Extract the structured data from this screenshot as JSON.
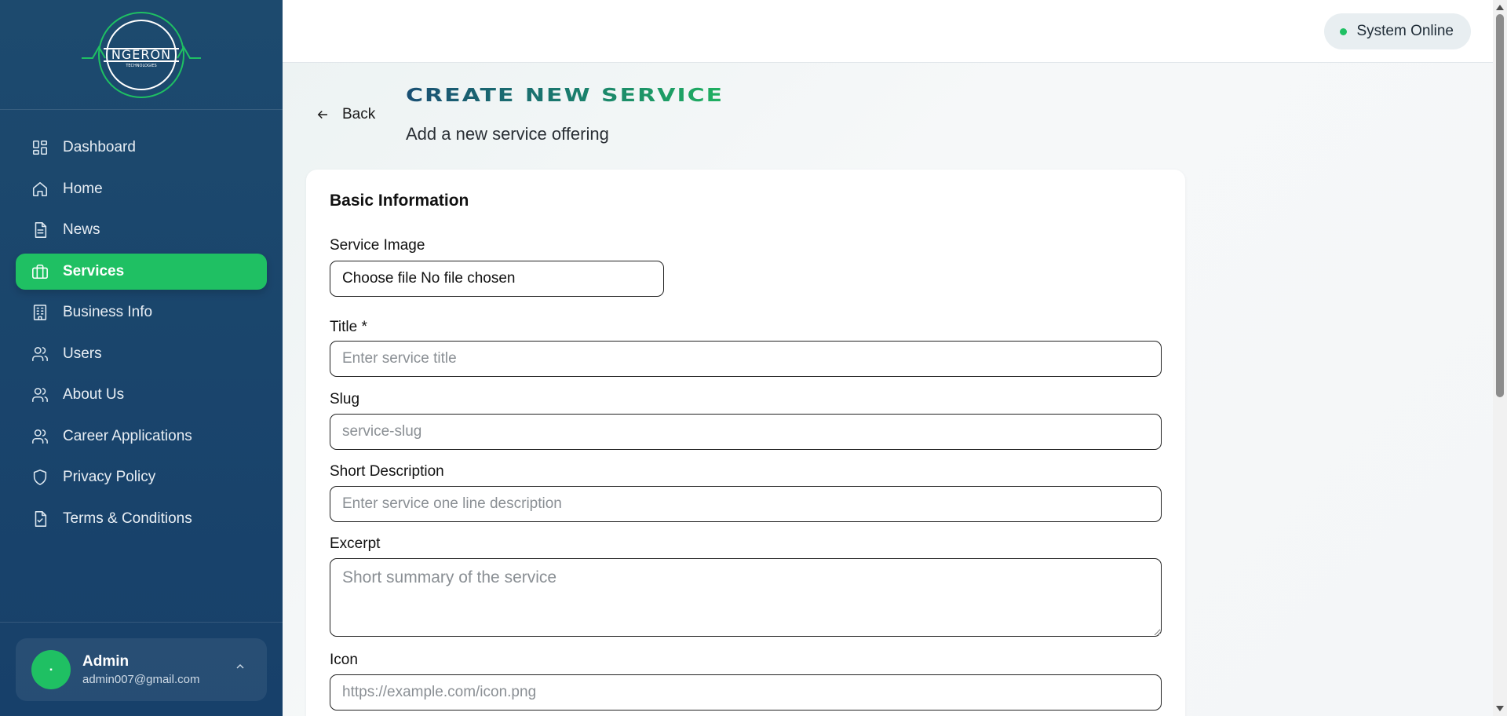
{
  "sidebar": {
    "logo_icon": "angeron-technologies-logo",
    "items": [
      {
        "label": "Dashboard",
        "icon": "dashboard-icon",
        "active": false
      },
      {
        "label": "Home",
        "icon": "home-icon",
        "active": false
      },
      {
        "label": "News",
        "icon": "news-icon",
        "active": false
      },
      {
        "label": "Services",
        "icon": "briefcase-icon",
        "active": true
      },
      {
        "label": "Business Info",
        "icon": "building-icon",
        "active": false
      },
      {
        "label": "Users",
        "icon": "users-icon",
        "active": false
      },
      {
        "label": "About Us",
        "icon": "users-icon",
        "active": false
      },
      {
        "label": "Career Applications",
        "icon": "users-icon",
        "active": false
      },
      {
        "label": "Privacy Policy",
        "icon": "shield-icon",
        "active": false
      },
      {
        "label": "Terms & Conditions",
        "icon": "file-check-icon",
        "active": false
      }
    ],
    "user": {
      "name": "Admin",
      "email": "admin007@gmail.com"
    }
  },
  "header": {
    "status_text": "System Online",
    "status_color": "#1fc063"
  },
  "page": {
    "back_label": "Back",
    "title": "Create New Service",
    "subtitle": "Add a new service offering"
  },
  "form": {
    "section_title": "Basic Information",
    "service_image": {
      "label": "Service Image",
      "button_label": "Choose file",
      "status": "No file chosen"
    },
    "title": {
      "label": "Title *",
      "placeholder": "Enter service title",
      "value": ""
    },
    "slug": {
      "label": "Slug",
      "placeholder": "service-slug",
      "value": ""
    },
    "short_description": {
      "label": "Short Description",
      "placeholder": "Enter service one line description",
      "value": ""
    },
    "excerpt": {
      "label": "Excerpt",
      "placeholder": "Short summary of the service",
      "value": ""
    },
    "icon": {
      "label": "Icon",
      "placeholder": "https://example.com/icon.png",
      "value": ""
    }
  },
  "colors": {
    "sidebar_bg": "#1d4a6e",
    "accent_green": "#1fc063"
  }
}
